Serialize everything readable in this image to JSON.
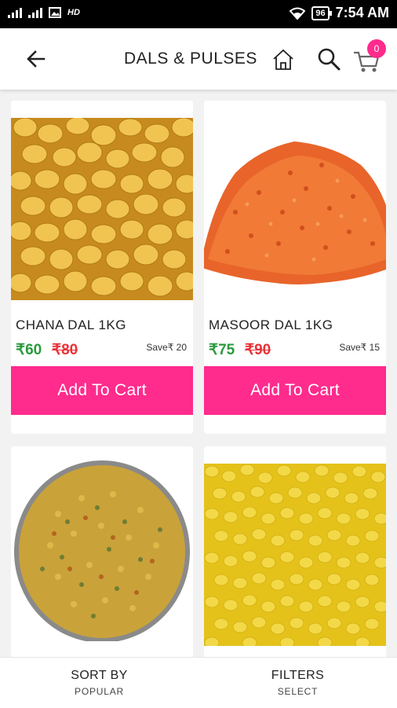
{
  "status_bar": {
    "network_label": "HD",
    "battery": "96",
    "time": "7:54 AM"
  },
  "toolbar": {
    "title": "DALS & PULSES",
    "cart_count": "0"
  },
  "products": [
    {
      "name": "CHANA DAL 1KG",
      "price": "₹60",
      "mrp": "₹80",
      "save": "Save₹ 20",
      "add_label": "Add To Cart"
    },
    {
      "name": "MASOOR DAL 1KG",
      "price": "₹75",
      "mrp": "₹90",
      "save": "Save₹ 15",
      "add_label": "Add To Cart"
    },
    {
      "name": "",
      "price": "",
      "mrp": "",
      "save": "",
      "add_label": ""
    },
    {
      "name": "",
      "price": "",
      "mrp": "",
      "save": "",
      "add_label": ""
    }
  ],
  "bottom_bar": {
    "sort_title": "SORT BY",
    "sort_value": "POPULAR",
    "filter_title": "FILTERS",
    "filter_value": "SELECT"
  },
  "colors": {
    "accent": "#ff2b8d",
    "price_green": "#2a9a3e",
    "mrp_red": "#e8333a"
  }
}
